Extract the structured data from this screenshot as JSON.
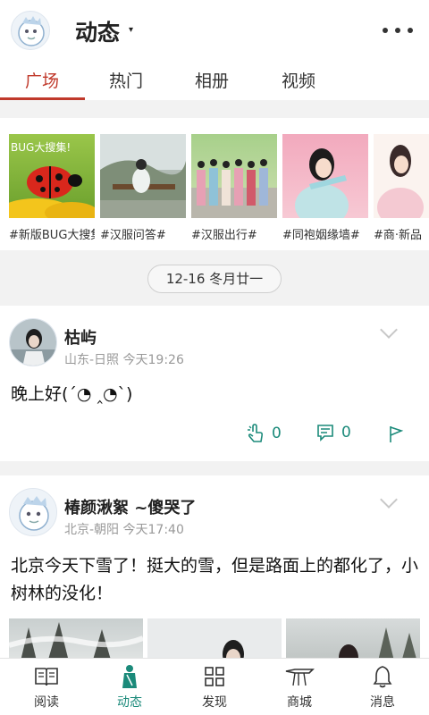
{
  "header": {
    "title": "动态",
    "caret": "▾"
  },
  "tabs": [
    {
      "label": "广场",
      "active": true
    },
    {
      "label": "热门",
      "active": false
    },
    {
      "label": "相册",
      "active": false
    },
    {
      "label": "视频",
      "active": false
    }
  ],
  "topics": [
    {
      "label": "#新版BUG大搜集！#",
      "thumb_text": "BUG大搜集!"
    },
    {
      "label": "#汉服问答#"
    },
    {
      "label": "#汉服出行#"
    },
    {
      "label": "#同袍姻缘墙#"
    },
    {
      "label": "#商·新品"
    }
  ],
  "date_pill": "12-16 冬月廿一",
  "posts": [
    {
      "name": "枯屿",
      "location": "山东-日照",
      "time": "今天19:26",
      "text": "晚上好(´◔ ‸◔`)",
      "likes": "0",
      "comments": "0"
    },
    {
      "name": "椿颜湫絮 ~傻哭了",
      "location": "北京-朝阳",
      "time": "今天17:40",
      "text": "北京今天下雪了！挺大的雪，但是路面上的都化了，小树林的没化！"
    }
  ],
  "bottom_nav": [
    {
      "label": "阅读",
      "icon": "book-icon"
    },
    {
      "label": "动态",
      "icon": "figure-icon",
      "active": true
    },
    {
      "label": "发现",
      "icon": "grid-icon"
    },
    {
      "label": "商城",
      "icon": "shop-icon"
    },
    {
      "label": "消息",
      "icon": "bell-icon"
    }
  ],
  "colors": {
    "accent_red": "#c0392b",
    "accent_teal": "#1b8a7a"
  }
}
